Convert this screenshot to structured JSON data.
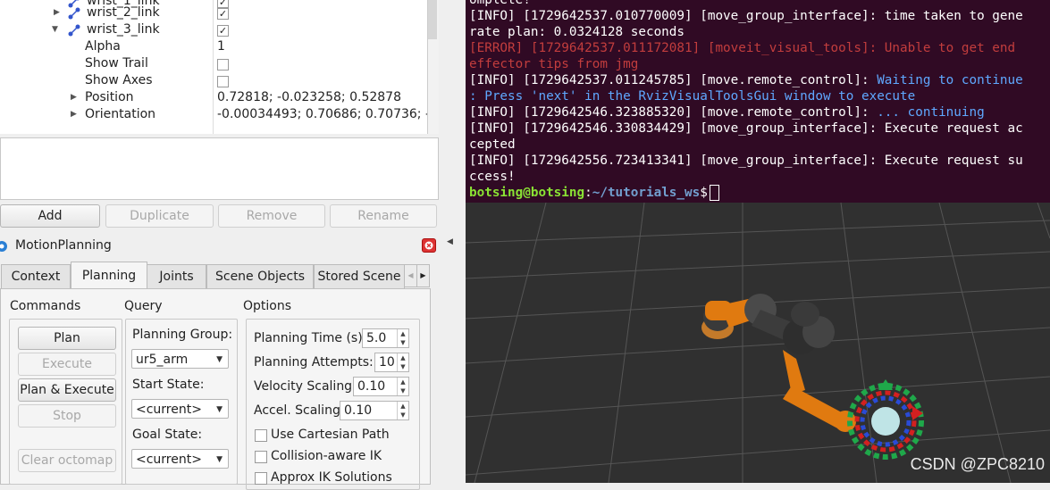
{
  "tree": {
    "rows": [
      {
        "label": "wrist_1_link",
        "value": "✓"
      },
      {
        "label": "wrist_2_link",
        "value": "✓"
      },
      {
        "label": "wrist_3_link",
        "value": "✓"
      },
      {
        "label": "Alpha",
        "value": "1"
      },
      {
        "label": "Show Trail",
        "value": ""
      },
      {
        "label": "Show Axes",
        "value": ""
      },
      {
        "label": "Position",
        "value": "0.72818; -0.023258; 0.52878"
      },
      {
        "label": "Orientation",
        "value": "-0.00034493; 0.70686; 0.70736; -0."
      }
    ]
  },
  "display_buttons": {
    "add": "Add",
    "duplicate": "Duplicate",
    "remove": "Remove",
    "rename": "Rename"
  },
  "motion_planning": {
    "title": "MotionPlanning",
    "tabs": [
      "Context",
      "Planning",
      "Joints",
      "Scene Objects",
      "Stored Scene"
    ],
    "active_tab": "Planning",
    "commands": {
      "header": "Commands",
      "plan": "Plan",
      "execute": "Execute",
      "plan_execute": "Plan & Execute",
      "stop": "Stop",
      "clear_octomap": "Clear octomap"
    },
    "query": {
      "header": "Query",
      "planning_group_label": "Planning Group:",
      "planning_group_value": "ur5_arm",
      "start_state_label": "Start State:",
      "start_state_value": "<current>",
      "goal_state_label": "Goal State:",
      "goal_state_value": "<current>"
    },
    "options": {
      "header": "Options",
      "planning_time_label": "Planning Time (s):",
      "planning_time_value": "5.0",
      "planning_attempts_label": "Planning Attempts:",
      "planning_attempts_value": "10",
      "velocity_scaling_label": "Velocity Scaling:",
      "velocity_scaling_value": "0.10",
      "accel_scaling_label": "Accel. Scaling:",
      "accel_scaling_value": "0.10",
      "cartesian_path": "Use Cartesian Path",
      "collision_aware_ik": "Collision-aware IK",
      "approx_ik": "Approx IK Solutions"
    }
  },
  "terminal": {
    "line1": "omplete!",
    "line2": "[INFO] [1729642537.010770009] [move_group_interface]: time taken to gene",
    "line3": "rate plan: 0.0324128 seconds",
    "line4": "[ERROR] [1729642537.011172081] [moveit_visual_tools]: Unable to get end",
    "line5": "effector tips from jmg",
    "line6a": "[INFO] [1729642537.011245785] [move.remote_control]: ",
    "line6b": "Waiting to continue",
    "line7": ": Press 'next' in the RvizVisualToolsGui window to execute",
    "line8a": "[INFO] [1729642546.323885320] [move.remote_control]: ",
    "line8b": "... continuing",
    "line9": "[INFO] [1729642546.330834429] [move_group_interface]: Execute request ac",
    "line10": "cepted",
    "line11": "[INFO] [1729642556.723413341] [move_group_interface]: Execute request su",
    "line12": "ccess!",
    "prompt_user": "botsing@botsing",
    "prompt_path": "~/tutorials_ws",
    "prompt_sym": "$"
  },
  "watermark": "CSDN @ZPC8210",
  "colors": {
    "terminal_bg": "#300a24",
    "viewport_bg": "#303030",
    "robot_orange": "#e07a10"
  }
}
